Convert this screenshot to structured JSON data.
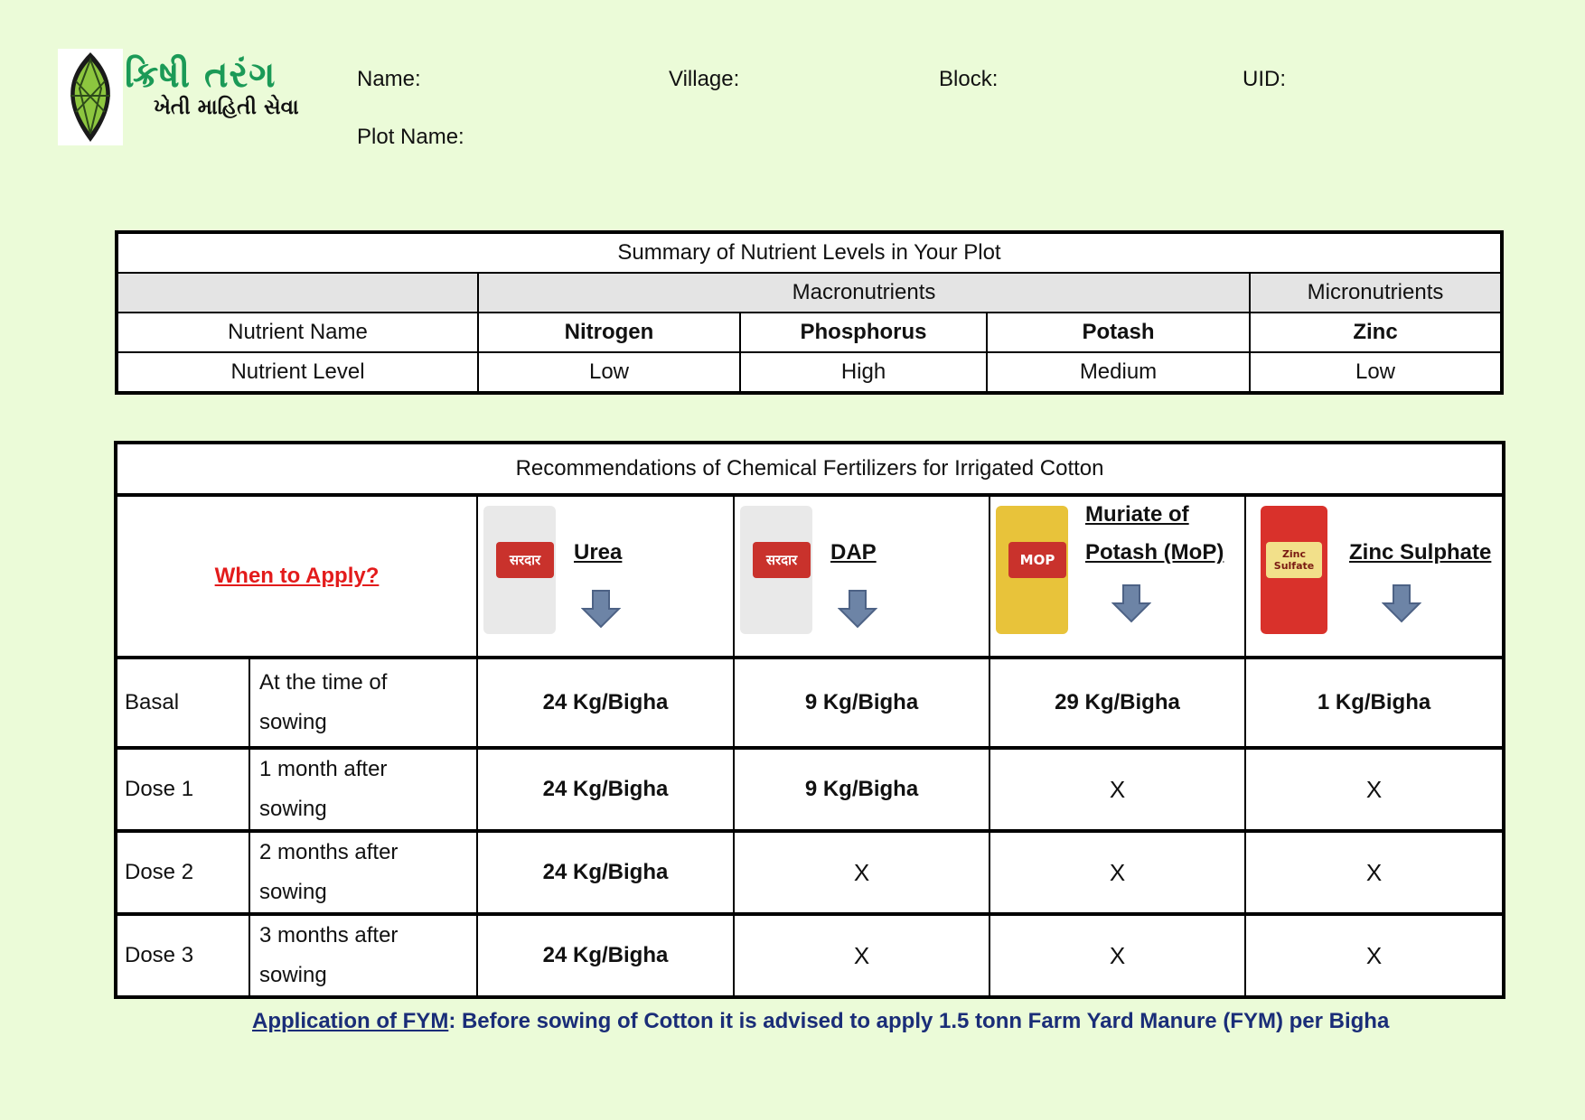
{
  "header": {
    "logo_title": "ક્રિષી તરંગ",
    "logo_subtitle": "ખેતી માહિતી સેવા",
    "name_label": "Name:",
    "village_label": "Village:",
    "block_label": "Block:",
    "uid_label": "UID:",
    "plot_label": "Plot Name:"
  },
  "summary": {
    "title": "Summary of Nutrient Levels in Your Plot",
    "macro_label": "Macronutrients",
    "micro_label": "Micronutrients",
    "name_row_label": "Nutrient Name",
    "level_row_label": "Nutrient Level",
    "nutrients": [
      {
        "name": "Nitrogen",
        "level": "Low"
      },
      {
        "name": "Phosphorus",
        "level": "High"
      },
      {
        "name": "Potash",
        "level": "Medium"
      },
      {
        "name": "Zinc",
        "level": "Low"
      }
    ]
  },
  "recommendations": {
    "title": "Recommendations of Chemical Fertilizers for Irrigated Cotton",
    "when_label": "When to Apply?",
    "products": [
      {
        "name": "Urea",
        "bag_text": "सरदार",
        "bag_color": "#e9e9e9"
      },
      {
        "name": "DAP",
        "bag_text": "सरदार",
        "bag_color": "#e9e9e9"
      },
      {
        "name_line1": "Muriate of",
        "name_line2": "Potash (MoP)",
        "bag_text": "MOP",
        "bag_color": "#e8c33a"
      },
      {
        "name": "Zinc Sulphate",
        "bag_text": "Zinc Sulfate",
        "bag_color": "#d9312b"
      }
    ],
    "rows": [
      {
        "dose": "Basal",
        "when_line1": "At the time of",
        "when_line2": "sowing",
        "values": [
          "24 Kg/Bigha",
          "9 Kg/Bigha",
          "29 Kg/Bigha",
          "1 Kg/Bigha"
        ]
      },
      {
        "dose": "Dose 1",
        "when_line1": "1 month after",
        "when_line2": "sowing",
        "values": [
          "24 Kg/Bigha",
          "9 Kg/Bigha",
          "X",
          "X"
        ]
      },
      {
        "dose": "Dose 2",
        "when_line1": "2 months after",
        "when_line2": "sowing",
        "values": [
          "24 Kg/Bigha",
          "X",
          "X",
          "X"
        ]
      },
      {
        "dose": "Dose 3",
        "when_line1": "3 months after",
        "when_line2": "sowing",
        "values": [
          "24 Kg/Bigha",
          "X",
          "X",
          "X"
        ]
      }
    ]
  },
  "footer": {
    "fym_lead": "Application of FYM",
    "fym_text": ": Before sowing of Cotton it is advised to apply 1.5 tonn Farm Yard Manure (FYM) per Bigha"
  },
  "colors": {
    "background": "#ebfbd8",
    "logo_green": "#1b9a57",
    "when_red": "#e31b1b",
    "footer_blue": "#1a2d78",
    "arrow_fill": "#6d84a6"
  }
}
